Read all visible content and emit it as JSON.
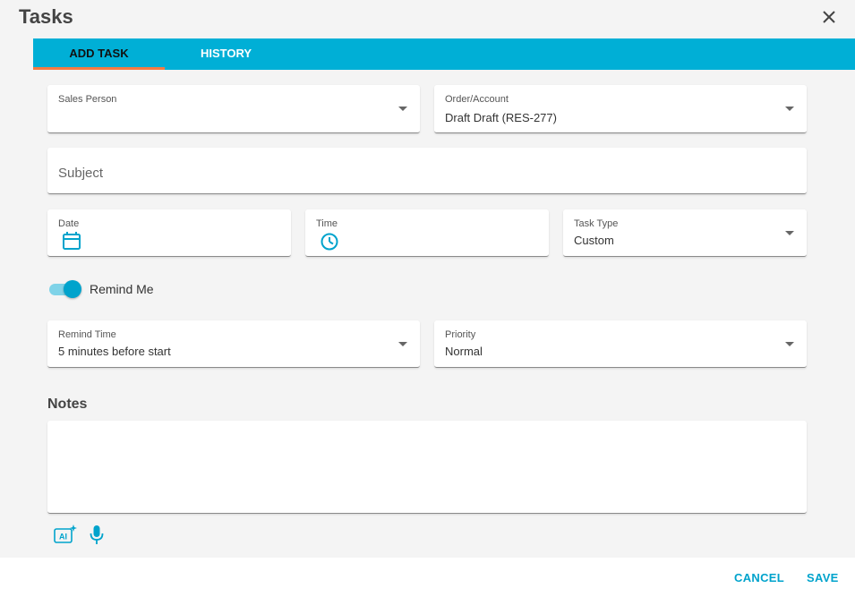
{
  "header": {
    "title": "Tasks"
  },
  "tabs": [
    {
      "label": "ADD TASK"
    },
    {
      "label": "HISTORY"
    }
  ],
  "form": {
    "sales_person": {
      "label": "Sales Person",
      "value": ""
    },
    "order_account": {
      "label": "Order/Account",
      "value": "Draft Draft (RES-277)"
    },
    "subject": {
      "placeholder": "Subject"
    },
    "date": {
      "label": "Date"
    },
    "time": {
      "label": "Time"
    },
    "task_type": {
      "label": "Task Type",
      "value": "Custom"
    },
    "remind_me": {
      "label": "Remind Me",
      "enabled": true
    },
    "remind_time": {
      "label": "Remind Time",
      "value": "5 minutes before start"
    },
    "priority": {
      "label": "Priority",
      "value": "Normal"
    }
  },
  "notes": {
    "title": "Notes",
    "value": ""
  },
  "tools": {
    "ai_label": "AI"
  },
  "footer": {
    "cancel_label": "CANCEL",
    "save_label": "SAVE"
  },
  "colors": {
    "accent": "#00afd6",
    "tab_indicator": "#f47a42",
    "icon": "#00a3cc"
  }
}
